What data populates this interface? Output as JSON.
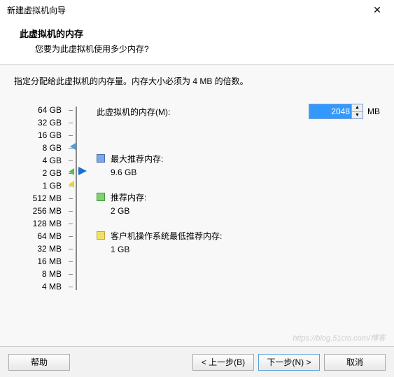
{
  "window": {
    "title": "新建虚拟机向导"
  },
  "header": {
    "heading": "此虚拟机的内存",
    "sub": "您要为此虚拟机使用多少内存?"
  },
  "intro": "指定分配给此虚拟机的内存量。内存大小必须为 4 MB 的倍数。",
  "memory": {
    "label": "此虚拟机的内存(M):",
    "value": "2048",
    "unit": "MB"
  },
  "scale": [
    "64 GB",
    "32 GB",
    "16 GB",
    "8 GB",
    "4 GB",
    "2 GB",
    "1 GB",
    "512 MB",
    "256 MB",
    "128 MB",
    "64 MB",
    "32 MB",
    "16 MB",
    "8 MB",
    "4 MB"
  ],
  "recs": {
    "max": {
      "title": "最大推荐内存:",
      "value": "9.6 GB"
    },
    "rec": {
      "title": "推荐内存:",
      "value": "2 GB"
    },
    "min": {
      "title": "客户机操作系统最低推荐内存:",
      "value": "1 GB"
    }
  },
  "buttons": {
    "help": "帮助",
    "back": "< 上一步(B)",
    "next": "下一步(N) >",
    "cancel": "取消"
  },
  "watermark": "https://blog.51cto.com/博客"
}
